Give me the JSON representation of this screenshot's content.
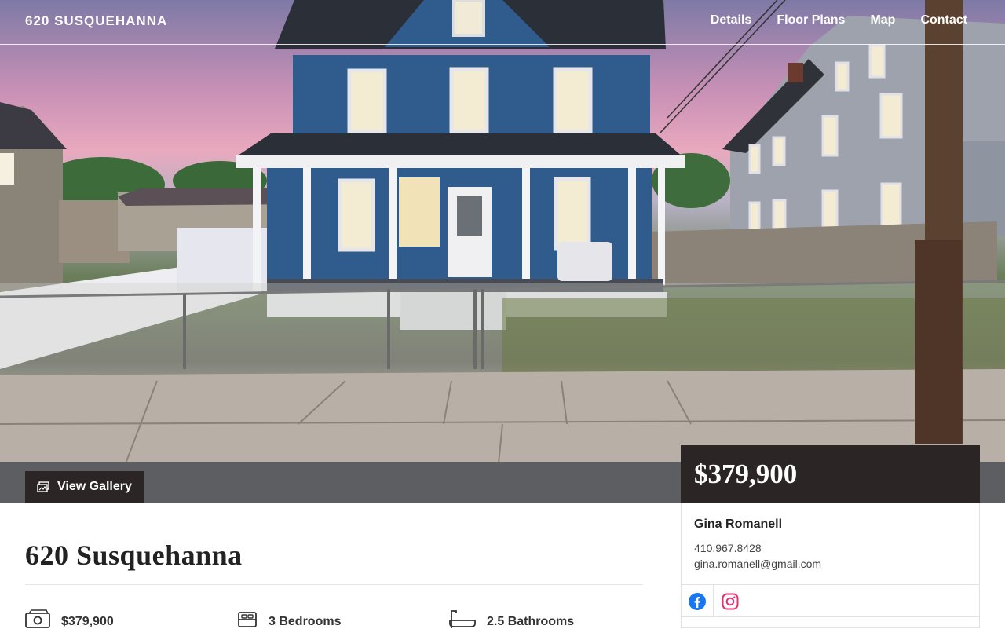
{
  "site": {
    "brand": "620 SUSQUEHANNA"
  },
  "nav": [
    {
      "label": "Details"
    },
    {
      "label": "Floor Plans"
    },
    {
      "label": "Map"
    },
    {
      "label": "Contact"
    }
  ],
  "hero": {
    "gallery_label": "View Gallery"
  },
  "price": "$379,900",
  "agent": {
    "name": "Gina Romanell",
    "phone": "410.967.8428",
    "email": "gina.romanell@gmail.com"
  },
  "listing": {
    "title": "620 Susquehanna",
    "facts": [
      {
        "icon": "money-icon",
        "label": "$379,900"
      },
      {
        "icon": "bed-icon",
        "label": "3 Bedrooms"
      },
      {
        "icon": "bathtub-icon",
        "label": "2.5 Bathrooms"
      }
    ]
  },
  "colors": {
    "dark_panel": "#2b2625",
    "house_blue": "#2f5b8d",
    "facebook": "#1877f2",
    "instagram": "#e1306c"
  }
}
